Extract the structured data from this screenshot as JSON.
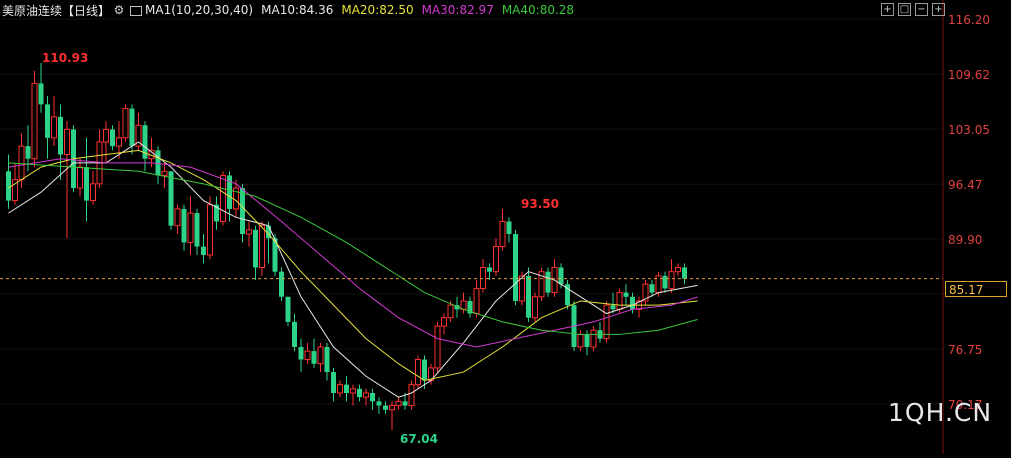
{
  "legend": {
    "title": "美原油连续",
    "period": "【日线】",
    "ma_label": "MA1(10,20,30,40)",
    "ma10": "MA10:84.36",
    "ma20": "MA20:82.50",
    "ma30": "MA30:82.97",
    "ma40": "MA40:80.28"
  },
  "colors": {
    "up": "#ff3030",
    "down": "#2ed38a",
    "ma10": "#e8e8e8",
    "ma20": "#e6e23a",
    "ma30": "#d23ad2",
    "ma40": "#3bc83b",
    "current_line": "#e0a030"
  },
  "price_axis": [
    "116.20",
    "109.62",
    "103.05",
    "96.47",
    "89.90",
    "76.75",
    "70.17"
  ],
  "current_price": "85.17",
  "annotations": {
    "high_label": "110.93",
    "mid_label": "93.50",
    "low_label": "67.04"
  },
  "watermark": "1QH.CN",
  "chart_data": {
    "type": "candlestick",
    "title": "美原油连续【日线】",
    "ylim": [
      67.04,
      116.2
    ],
    "current_price": 85.17,
    "candles": [
      [
        98.0,
        94.5,
        100.0,
        93.5
      ],
      [
        94.5,
        97.0,
        99.0,
        94.0
      ],
      [
        97.0,
        101.0,
        102.5,
        96.0
      ],
      [
        101.0,
        99.5,
        103.5,
        98.0
      ],
      [
        99.5,
        108.5,
        110.0,
        98.5
      ],
      [
        108.5,
        106.0,
        110.93,
        105.0
      ],
      [
        106.0,
        102.0,
        107.0,
        99.5
      ],
      [
        102.0,
        104.5,
        107.0,
        101.0
      ],
      [
        104.5,
        100.0,
        106.0,
        97.0
      ],
      [
        100.0,
        103.0,
        104.0,
        90.0
      ],
      [
        103.0,
        96.0,
        103.5,
        95.5
      ],
      [
        96.0,
        98.5,
        99.5,
        95.0
      ],
      [
        98.5,
        94.5,
        102.0,
        92.0
      ],
      [
        94.5,
        96.5,
        98.0,
        94.0
      ],
      [
        96.5,
        101.5,
        103.0,
        96.0
      ],
      [
        101.5,
        103.0,
        104.0,
        99.0
      ],
      [
        103.0,
        101.0,
        103.5,
        100.5
      ],
      [
        101.0,
        102.0,
        104.0,
        99.5
      ],
      [
        102.0,
        105.5,
        106.0,
        101.5
      ],
      [
        105.5,
        101.0,
        106.0,
        100.0
      ],
      [
        101.0,
        103.5,
        105.0,
        100.5
      ],
      [
        103.5,
        99.5,
        104.0,
        98.0
      ],
      [
        99.5,
        100.5,
        102.0,
        98.5
      ],
      [
        100.5,
        97.5,
        101.0,
        96.5
      ],
      [
        97.5,
        98.0,
        99.0,
        96.0
      ],
      [
        98.0,
        91.5,
        98.0,
        91.0
      ],
      [
        91.5,
        93.5,
        94.0,
        90.5
      ],
      [
        93.5,
        89.5,
        94.0,
        88.5
      ],
      [
        89.5,
        93.0,
        95.0,
        88.0
      ],
      [
        93.0,
        89.0,
        93.5,
        88.0
      ],
      [
        89.0,
        88.0,
        90.5,
        87.0
      ],
      [
        88.0,
        94.0,
        95.0,
        87.5
      ],
      [
        94.0,
        92.0,
        95.0,
        91.0
      ],
      [
        92.0,
        97.5,
        98.0,
        91.5
      ],
      [
        97.5,
        93.5,
        98.0,
        92.0
      ],
      [
        93.5,
        96.0,
        97.0,
        92.5
      ],
      [
        96.0,
        90.5,
        96.5,
        89.5
      ],
      [
        90.5,
        91.0,
        92.0,
        89.0
      ],
      [
        91.0,
        86.5,
        91.5,
        85.0
      ],
      [
        86.5,
        91.5,
        92.0,
        85.5
      ],
      [
        91.5,
        90.0,
        92.0,
        87.0
      ],
      [
        90.0,
        86.0,
        90.5,
        85.5
      ],
      [
        86.0,
        83.0,
        86.5,
        82.5
      ],
      [
        83.0,
        80.0,
        83.0,
        79.5
      ],
      [
        80.0,
        77.0,
        81.0,
        76.5
      ],
      [
        77.0,
        75.5,
        78.0,
        74.0
      ],
      [
        75.5,
        76.5,
        77.5,
        75.0
      ],
      [
        76.5,
        75.0,
        78.0,
        74.5
      ],
      [
        75.0,
        77.0,
        77.5,
        74.0
      ],
      [
        77.0,
        74.0,
        77.5,
        73.0
      ],
      [
        74.0,
        71.5,
        74.5,
        70.5
      ],
      [
        71.5,
        72.5,
        73.0,
        71.0
      ],
      [
        72.5,
        71.5,
        73.5,
        70.5
      ],
      [
        71.5,
        72.0,
        72.5,
        70.0
      ],
      [
        72.0,
        71.0,
        72.5,
        70.5
      ],
      [
        71.0,
        71.5,
        72.0,
        70.0
      ],
      [
        71.5,
        70.5,
        72.0,
        69.5
      ],
      [
        70.5,
        70.0,
        71.0,
        69.0
      ],
      [
        70.0,
        69.5,
        70.5,
        69.0
      ],
      [
        69.5,
        70.0,
        70.5,
        67.04
      ],
      [
        70.0,
        70.5,
        71.0,
        69.5
      ],
      [
        70.5,
        70.0,
        71.5,
        69.5
      ],
      [
        70.0,
        72.5,
        73.0,
        69.5
      ],
      [
        72.5,
        75.5,
        76.0,
        72.0
      ],
      [
        75.5,
        73.0,
        76.0,
        72.0
      ],
      [
        73.0,
        74.5,
        75.0,
        72.5
      ],
      [
        74.5,
        79.5,
        80.0,
        74.0
      ],
      [
        79.5,
        80.5,
        81.0,
        78.5
      ],
      [
        80.5,
        82.0,
        82.5,
        80.0
      ],
      [
        82.0,
        81.5,
        83.0,
        80.5
      ],
      [
        81.5,
        82.5,
        83.5,
        81.0
      ],
      [
        82.5,
        81.0,
        83.0,
        80.5
      ],
      [
        81.0,
        84.0,
        85.0,
        80.5
      ],
      [
        84.0,
        86.5,
        87.5,
        83.5
      ],
      [
        86.5,
        86.0,
        87.0,
        85.0
      ],
      [
        86.0,
        89.0,
        90.0,
        85.5
      ],
      [
        89.0,
        92.0,
        93.5,
        88.5
      ],
      [
        92.0,
        90.5,
        92.5,
        89.5
      ],
      [
        90.5,
        82.5,
        91.0,
        82.0
      ],
      [
        82.5,
        85.5,
        86.0,
        82.0
      ],
      [
        85.5,
        80.5,
        86.5,
        80.0
      ],
      [
        80.5,
        83.0,
        83.5,
        80.0
      ],
      [
        83.0,
        86.0,
        86.5,
        82.5
      ],
      [
        86.0,
        83.5,
        86.5,
        83.0
      ],
      [
        83.5,
        86.5,
        87.5,
        83.0
      ],
      [
        86.5,
        84.5,
        87.0,
        84.0
      ],
      [
        84.5,
        82.0,
        85.0,
        81.5
      ],
      [
        82.0,
        77.0,
        82.5,
        76.5
      ],
      [
        77.0,
        78.5,
        79.0,
        76.5
      ],
      [
        78.5,
        77.0,
        79.0,
        76.0
      ],
      [
        77.0,
        79.0,
        79.5,
        76.5
      ],
      [
        79.0,
        78.0,
        80.0,
        77.5
      ],
      [
        78.0,
        82.0,
        82.5,
        77.5
      ],
      [
        82.0,
        81.5,
        83.5,
        81.0
      ],
      [
        81.5,
        83.5,
        84.0,
        81.0
      ],
      [
        83.5,
        83.0,
        84.5,
        82.0
      ],
      [
        83.0,
        81.5,
        83.5,
        81.0
      ],
      [
        81.5,
        82.5,
        83.0,
        80.5
      ],
      [
        82.5,
        84.5,
        85.0,
        82.0
      ],
      [
        84.5,
        83.5,
        85.0,
        83.0
      ],
      [
        83.5,
        85.5,
        86.0,
        83.0
      ],
      [
        85.5,
        84.0,
        86.0,
        83.5
      ],
      [
        84.0,
        86.0,
        87.5,
        83.5
      ],
      [
        86.0,
        86.5,
        87.0,
        85.5
      ],
      [
        86.5,
        85.17,
        87.0,
        84.5
      ]
    ],
    "ma": [
      {
        "name": "MA10",
        "values": [
          [
            0,
            93.0
          ],
          [
            5,
            95.5
          ],
          [
            10,
            99.0
          ],
          [
            15,
            99.0
          ],
          [
            20,
            101.5
          ],
          [
            25,
            98.5
          ],
          [
            30,
            94.5
          ],
          [
            35,
            92.5
          ],
          [
            40,
            91.5
          ],
          [
            45,
            83.0
          ],
          [
            50,
            77.0
          ],
          [
            55,
            73.5
          ],
          [
            60,
            71.0
          ],
          [
            62,
            71.5
          ],
          [
            65,
            73.0
          ],
          [
            70,
            77.5
          ],
          [
            75,
            82.5
          ],
          [
            80,
            86.0
          ],
          [
            84,
            85.0
          ],
          [
            88,
            83.0
          ],
          [
            92,
            81.0
          ],
          [
            96,
            82.0
          ],
          [
            100,
            83.5
          ],
          [
            106,
            84.36
          ]
        ]
      },
      {
        "name": "MA20",
        "values": [
          [
            0,
            96.0
          ],
          [
            5,
            98.5
          ],
          [
            10,
            99.5
          ],
          [
            15,
            100.0
          ],
          [
            20,
            100.5
          ],
          [
            25,
            99.0
          ],
          [
            30,
            97.0
          ],
          [
            35,
            94.5
          ],
          [
            40,
            90.5
          ],
          [
            45,
            86.0
          ],
          [
            50,
            82.0
          ],
          [
            55,
            78.0
          ],
          [
            60,
            75.0
          ],
          [
            64,
            73.0
          ],
          [
            70,
            74.0
          ],
          [
            76,
            77.0
          ],
          [
            82,
            80.5
          ],
          [
            88,
            82.5
          ],
          [
            94,
            82.0
          ],
          [
            100,
            82.0
          ],
          [
            106,
            82.5
          ]
        ]
      },
      {
        "name": "MA30",
        "values": [
          [
            0,
            98.5
          ],
          [
            8,
            99.5
          ],
          [
            15,
            99.0
          ],
          [
            22,
            99.0
          ],
          [
            28,
            98.5
          ],
          [
            35,
            96.5
          ],
          [
            42,
            92.0
          ],
          [
            48,
            88.0
          ],
          [
            54,
            84.0
          ],
          [
            60,
            80.5
          ],
          [
            66,
            78.0
          ],
          [
            72,
            77.0
          ],
          [
            78,
            78.0
          ],
          [
            84,
            79.0
          ],
          [
            90,
            80.0
          ],
          [
            96,
            81.5
          ],
          [
            102,
            82.0
          ],
          [
            106,
            82.97
          ]
        ]
      },
      {
        "name": "MA40",
        "values": [
          [
            0,
            99.0
          ],
          [
            10,
            98.5
          ],
          [
            20,
            98.0
          ],
          [
            30,
            96.5
          ],
          [
            38,
            95.0
          ],
          [
            45,
            92.5
          ],
          [
            52,
            89.5
          ],
          [
            58,
            86.5
          ],
          [
            64,
            83.5
          ],
          [
            70,
            81.5
          ],
          [
            76,
            80.0
          ],
          [
            82,
            79.0
          ],
          [
            88,
            78.5
          ],
          [
            94,
            78.5
          ],
          [
            100,
            79.0
          ],
          [
            106,
            80.28
          ]
        ]
      }
    ]
  }
}
